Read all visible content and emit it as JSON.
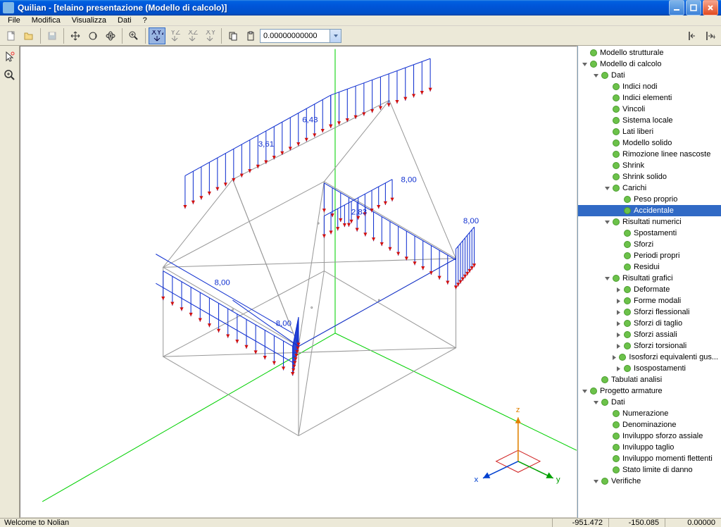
{
  "window": {
    "title": "Quilian - [telaino presentazione (Modello di calcolo)]"
  },
  "menu": {
    "items": [
      "File",
      "Modifica",
      "Visualizza",
      "Dati",
      "?"
    ]
  },
  "toolbar": {
    "value": "0.00000000000"
  },
  "statusbar": {
    "message": "Welcome to Nolian",
    "x": "-951.472",
    "y": "-150.085",
    "z": "0.00000"
  },
  "viewport": {
    "load_labels": [
      "6,43",
      "3,61",
      "8,00",
      "2,83",
      "8,00",
      "8,00",
      "8,00"
    ],
    "axes": {
      "x": "x",
      "y": "y",
      "z": "z"
    }
  },
  "tree": [
    {
      "indent": 0,
      "toggle": null,
      "label": "Modello strutturale"
    },
    {
      "indent": 0,
      "toggle": "open",
      "label": "Modello di calcolo"
    },
    {
      "indent": 1,
      "toggle": "open",
      "label": "Dati"
    },
    {
      "indent": 2,
      "toggle": null,
      "label": "Indici nodi"
    },
    {
      "indent": 2,
      "toggle": null,
      "label": "Indici elementi"
    },
    {
      "indent": 2,
      "toggle": null,
      "label": "Vincoli"
    },
    {
      "indent": 2,
      "toggle": null,
      "label": "Sistema locale"
    },
    {
      "indent": 2,
      "toggle": null,
      "label": "Lati liberi"
    },
    {
      "indent": 2,
      "toggle": null,
      "label": "Modello solido"
    },
    {
      "indent": 2,
      "toggle": null,
      "label": "Rimozione linee nascoste"
    },
    {
      "indent": 2,
      "toggle": null,
      "label": "Shrink"
    },
    {
      "indent": 2,
      "toggle": null,
      "label": "Shrink solido"
    },
    {
      "indent": 2,
      "toggle": "open",
      "label": "Carichi"
    },
    {
      "indent": 3,
      "toggle": null,
      "label": "Peso proprio"
    },
    {
      "indent": 3,
      "toggle": null,
      "label": "Accidentale",
      "selected": true
    },
    {
      "indent": 2,
      "toggle": "open",
      "label": "Risultati numerici"
    },
    {
      "indent": 3,
      "toggle": null,
      "label": "Spostamenti"
    },
    {
      "indent": 3,
      "toggle": null,
      "label": "Sforzi"
    },
    {
      "indent": 3,
      "toggle": null,
      "label": "Periodi propri"
    },
    {
      "indent": 3,
      "toggle": null,
      "label": "Residui"
    },
    {
      "indent": 2,
      "toggle": "open",
      "label": "Risultati grafici"
    },
    {
      "indent": 3,
      "toggle": "closed",
      "label": "Deformate"
    },
    {
      "indent": 3,
      "toggle": "closed",
      "label": "Forme modali"
    },
    {
      "indent": 3,
      "toggle": "closed",
      "label": "Sforzi flessionali"
    },
    {
      "indent": 3,
      "toggle": "closed",
      "label": "Sforzi di taglio"
    },
    {
      "indent": 3,
      "toggle": "closed",
      "label": "Sforzi assiali"
    },
    {
      "indent": 3,
      "toggle": "closed",
      "label": "Sforzi torsionali"
    },
    {
      "indent": 3,
      "toggle": "closed",
      "label": "Isosforzi equivalenti gus..."
    },
    {
      "indent": 3,
      "toggle": "closed",
      "label": "Isospostamenti"
    },
    {
      "indent": 1,
      "toggle": null,
      "label": "Tabulati analisi"
    },
    {
      "indent": 0,
      "toggle": "open",
      "label": "Progetto armature"
    },
    {
      "indent": 1,
      "toggle": "open",
      "label": "Dati"
    },
    {
      "indent": 2,
      "toggle": null,
      "label": "Numerazione"
    },
    {
      "indent": 2,
      "toggle": null,
      "label": "Denominazione"
    },
    {
      "indent": 2,
      "toggle": null,
      "label": "Inviluppo sforzo assiale"
    },
    {
      "indent": 2,
      "toggle": null,
      "label": "Inviluppo taglio"
    },
    {
      "indent": 2,
      "toggle": null,
      "label": "Inviluppo momenti flettenti"
    },
    {
      "indent": 2,
      "toggle": null,
      "label": "Stato limite di danno"
    },
    {
      "indent": 1,
      "toggle": "open",
      "label": "Verifiche"
    }
  ]
}
